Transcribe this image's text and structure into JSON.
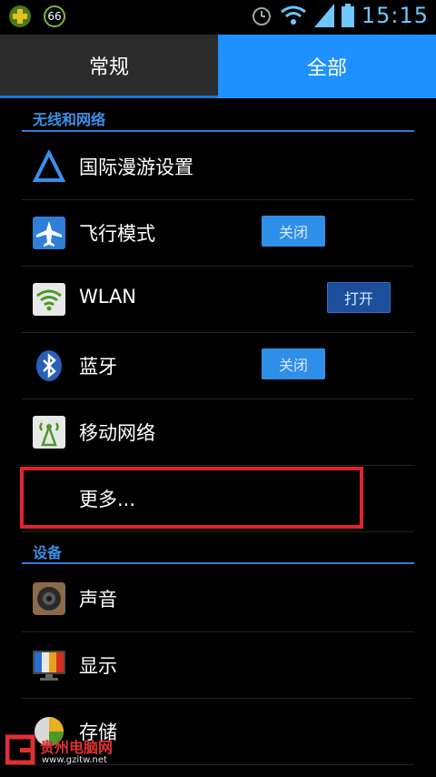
{
  "status_bar": {
    "time": "15:15",
    "badge_count": "66",
    "icons": [
      "plus-app-icon",
      "badge-66-icon",
      "alarm-icon",
      "wifi-icon",
      "signal-icon",
      "battery-icon"
    ]
  },
  "tabs": [
    {
      "label": "常规",
      "selected": false
    },
    {
      "label": "全部",
      "selected": true
    }
  ],
  "sections": {
    "wireless": {
      "title": "无线和网络",
      "items": [
        {
          "label": "国际漫游设置",
          "icon": "roaming-triangle-icon"
        },
        {
          "label": "飞行模式",
          "icon": "airplane-icon",
          "switch": "关闭"
        },
        {
          "label": "WLAN",
          "icon": "wifi-icon",
          "switch": "打开"
        },
        {
          "label": "蓝牙",
          "icon": "bluetooth-icon",
          "switch": "关闭"
        },
        {
          "label": "移动网络",
          "icon": "mobile-network-icon"
        },
        {
          "label": "更多..."
        }
      ]
    },
    "device": {
      "title": "设备",
      "items": [
        {
          "label": "声音",
          "icon": "speaker-icon"
        },
        {
          "label": "显示",
          "icon": "display-icon"
        },
        {
          "label": "存储",
          "icon": "storage-pie-icon"
        }
      ]
    }
  },
  "watermark": {
    "text": "贵州电脑网",
    "url": "www.gzitw.net"
  },
  "colors": {
    "accent": "#1e90ff",
    "highlight": "#e0242c"
  }
}
